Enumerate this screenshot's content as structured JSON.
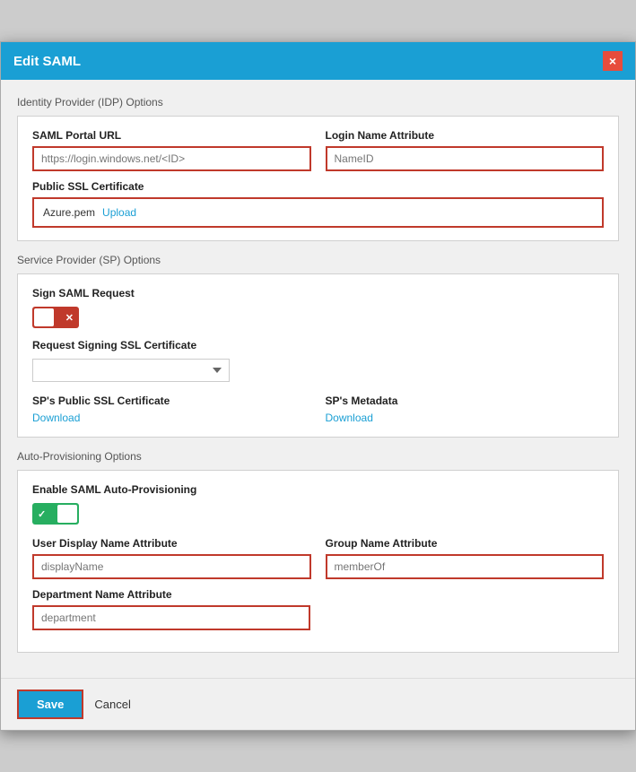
{
  "modal": {
    "title": "Edit SAML",
    "close_label": "×"
  },
  "idp_section": {
    "title": "Identity Provider (IDP) Options",
    "saml_portal_url": {
      "label": "SAML Portal URL",
      "placeholder": "https://login.windows.net/<ID>"
    },
    "login_name_attribute": {
      "label": "Login Name Attribute",
      "placeholder": "NameID"
    },
    "ssl_cert": {
      "label": "Public SSL Certificate",
      "filename": "Azure.pem",
      "upload_label": "Upload"
    }
  },
  "sp_section": {
    "title": "Service Provider (SP) Options",
    "sign_saml_request": {
      "label": "Sign SAML Request",
      "toggle_state": "off"
    },
    "request_signing_ssl": {
      "label": "Request Signing SSL Certificate",
      "options": [
        ""
      ]
    },
    "sp_public_ssl": {
      "label": "SP's Public SSL Certificate",
      "download_label": "Download"
    },
    "sp_metadata": {
      "label": "SP's Metadata",
      "download_label": "Download"
    }
  },
  "auto_provisioning": {
    "title": "Auto-Provisioning Options",
    "enable_label": "Enable SAML Auto-Provisioning",
    "toggle_state": "on",
    "user_display_name": {
      "label": "User Display Name Attribute",
      "placeholder": "displayName"
    },
    "group_name": {
      "label": "Group Name Attribute",
      "placeholder": "memberOf"
    },
    "department_name": {
      "label": "Department Name Attribute",
      "placeholder": "department"
    }
  },
  "footer": {
    "save_label": "Save",
    "cancel_label": "Cancel"
  }
}
